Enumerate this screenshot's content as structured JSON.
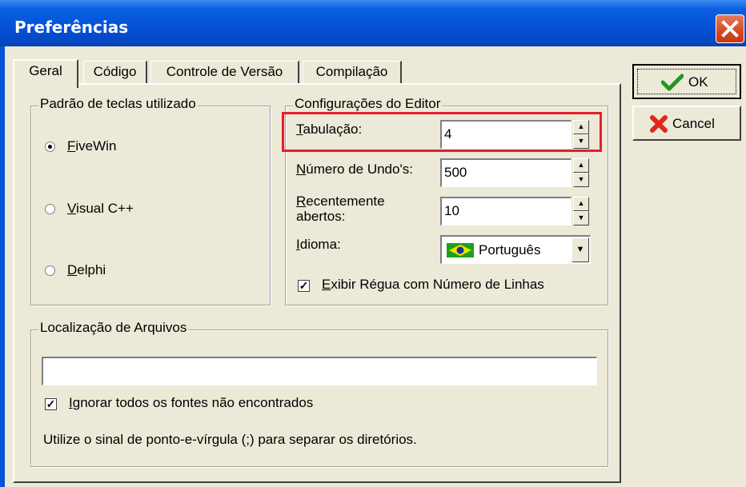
{
  "window": {
    "title": "Preferências"
  },
  "tabs": [
    "Geral",
    "Código",
    "Controle de Versão",
    "Compilação"
  ],
  "buttons": {
    "ok": "OK",
    "cancel": "Cancel"
  },
  "keyboard_group": {
    "label": "Padrão de teclas utilizado",
    "options": [
      {
        "mnemonic": "F",
        "rest": "iveWin",
        "selected": true
      },
      {
        "mnemonic": "V",
        "rest": "isual C++",
        "selected": false
      },
      {
        "mnemonic": "D",
        "rest": "elphi",
        "selected": false
      }
    ]
  },
  "editor_group": {
    "label": "Configurações do Editor",
    "tab_label_mn": "T",
    "tab_label_rest": "abulação:",
    "tab_value": "4",
    "undo_label_mn": "N",
    "undo_label_rest": "úmero de Undo's:",
    "undo_value": "500",
    "recent_label_mn": "R",
    "recent_label_rest": "ecentemente",
    "recent_label_line2": "abertos:",
    "recent_value": "10",
    "lang_label_mn": "I",
    "lang_label_rest": "dioma:",
    "lang_value": "Português",
    "ruler_mn": "E",
    "ruler_rest": "xibir Régua com Número de Linhas",
    "ruler_checked": true
  },
  "files_group": {
    "label": "Localização de Arquivos",
    "path_value": "",
    "ignore_mn": "I",
    "ignore_rest": "gnorar todos os fontes não encontrados",
    "ignore_checked": true,
    "hint": "Utilize o sinal de ponto-e-vírgula (;) para separar os diretórios."
  },
  "colors": {
    "title_bar": "#0553d8",
    "face": "#ece9d8",
    "highlight": "#e3202d"
  }
}
